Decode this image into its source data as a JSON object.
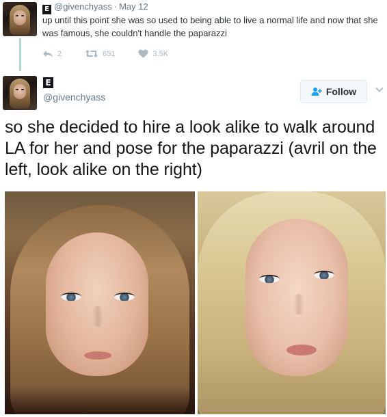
{
  "parent_tweet": {
    "badge_letter": "E",
    "handle": "@givenchyass",
    "separator": "·",
    "date": "May 12",
    "text": "up until this point she was so used to being able to live a normal life and now that she was famous, she couldn't handle the paparazzi",
    "actions": {
      "reply_count": "2",
      "retweet_count": "651",
      "like_count": "3.5K"
    }
  },
  "main_tweet": {
    "badge_letter": "E",
    "handle": "@givenchyass",
    "follow_label": "Follow",
    "text": "so she decided to hire a look alike to walk around LA for her and pose for the paparazzi (avril on the left, look alike on the right)"
  },
  "colors": {
    "accent": "#1da1f2",
    "muted": "#657786",
    "icon_gray": "#aab8c2",
    "thread_line": "#b0dcd4"
  },
  "icons": {
    "reply": "reply-icon",
    "retweet": "retweet-icon",
    "like": "heart-icon",
    "follow": "add-user-icon",
    "caret": "chevron-down-icon"
  }
}
